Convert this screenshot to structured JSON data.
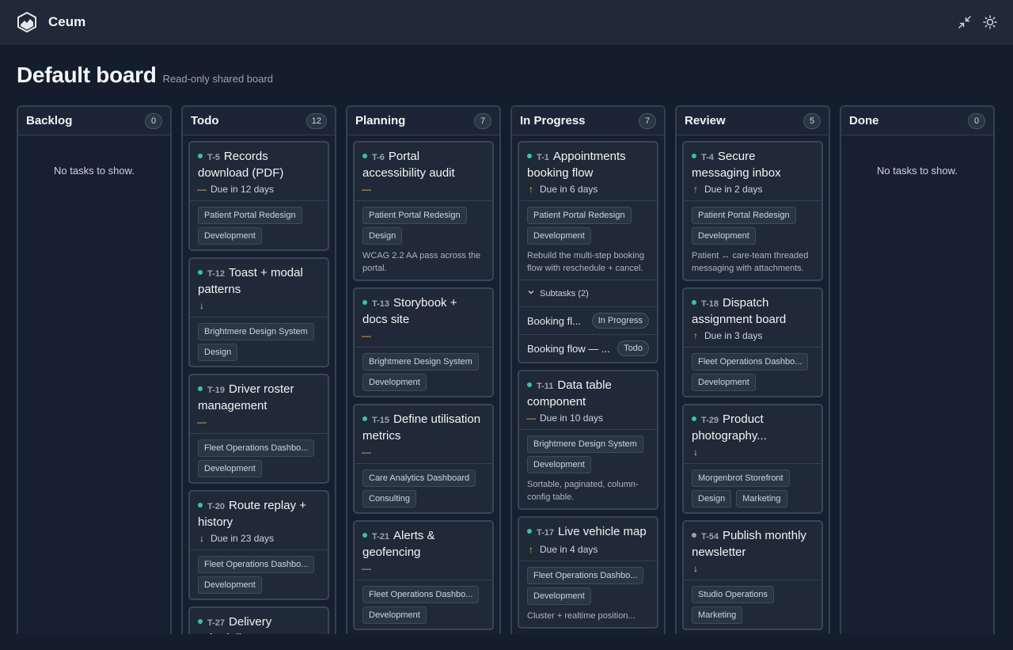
{
  "app": {
    "name": "Ceum"
  },
  "icons": {
    "collapse": "collapse-arrows-icon",
    "theme": "sun-icon"
  },
  "page": {
    "title": "Default board",
    "subtitle": "Read-only shared board"
  },
  "board": {
    "empty_text": "No tasks to show.",
    "subtasks_label": "Subtasks (2)",
    "columns": [
      {
        "title": "Backlog",
        "count": "0",
        "cards": []
      },
      {
        "title": "Todo",
        "count": "12",
        "cards": [
          {
            "id": "T-5",
            "title": "Records download (PDF)",
            "priority": "medium",
            "due": "Due in 12 days",
            "tags": [
              "Patient Portal Redesign",
              "Development"
            ]
          },
          {
            "id": "T-12",
            "title": "Toast + modal patterns",
            "priority": "low",
            "due": "",
            "tags": [
              "Brightmere Design System",
              "Design"
            ]
          },
          {
            "id": "T-19",
            "title": "Driver roster management",
            "priority": "medium",
            "due": "",
            "tags": [
              "Fleet Operations Dashbo...",
              "Development"
            ]
          },
          {
            "id": "T-20",
            "title": "Route replay + history",
            "priority": "low",
            "due": "Due in 23 days",
            "tags": [
              "Fleet Operations Dashbo...",
              "Development"
            ]
          },
          {
            "id": "T-27",
            "title": "Delivery scheduling...",
            "priority": "medium",
            "due": "",
            "tags": []
          }
        ]
      },
      {
        "title": "Planning",
        "count": "7",
        "cards": [
          {
            "id": "T-6",
            "title": "Portal accessibility audit",
            "priority": "medium",
            "due": "",
            "tags": [
              "Patient Portal Redesign",
              "Design"
            ],
            "description": "WCAG 2.2 AA pass across the portal."
          },
          {
            "id": "T-13",
            "title": "Storybook + docs site",
            "priority": "medium",
            "due": "",
            "tags": [
              "Brightmere Design System",
              "Development"
            ]
          },
          {
            "id": "T-15",
            "title": "Define utilisation metrics",
            "priority": "medium",
            "due": "",
            "tags": [
              "Care Analytics Dashboard",
              "Consulting"
            ]
          },
          {
            "id": "T-21",
            "title": "Alerts & geofencing",
            "priority": "medium",
            "due": "",
            "tags": [
              "Fleet Operations Dashbo...",
              "Development"
            ]
          }
        ]
      },
      {
        "title": "In Progress",
        "count": "7",
        "cards": [
          {
            "id": "T-1",
            "title": "Appointments booking flow",
            "priority": "high",
            "due": "Due in 6 days",
            "tags": [
              "Patient Portal Redesign",
              "Development"
            ],
            "description": "Rebuild the multi-step booking flow with reschedule + cancel.",
            "subtasks": [
              {
                "name": "Booking fl...",
                "status": "In Progress"
              },
              {
                "name": "Booking flow — ...",
                "status": "Todo"
              }
            ]
          },
          {
            "id": "T-11",
            "title": "Data table component",
            "priority": "medium",
            "due": "Due in 10 days",
            "tags": [
              "Brightmere Design System",
              "Development"
            ],
            "description": "Sortable, paginated, column-config table."
          },
          {
            "id": "T-17",
            "title": "Live vehicle map",
            "priority": "high",
            "due": "Due in 4 days",
            "tags": [
              "Fleet Operations Dashbo...",
              "Development"
            ],
            "description": "Cluster + realtime position..."
          }
        ]
      },
      {
        "title": "Review",
        "count": "5",
        "cards": [
          {
            "id": "T-4",
            "title": "Secure messaging inbox",
            "priority": "high",
            "due": "Due in 2 days",
            "tags": [
              "Patient Portal Redesign",
              "Development"
            ],
            "description": "Patient ↔ care-team threaded messaging with attachments."
          },
          {
            "id": "T-18",
            "title": "Dispatch assignment board",
            "priority": "high",
            "due": "Due in 3 days",
            "tags": [
              "Fleet Operations Dashbo...",
              "Development"
            ]
          },
          {
            "id": "T-29",
            "title": "Product photography...",
            "priority": "low",
            "due": "",
            "tags": [
              "Morgenbrot Storefront",
              "Design",
              "Marketing"
            ]
          },
          {
            "id": "T-54",
            "title": "Publish monthly newsletter",
            "priority": "low",
            "due": "",
            "tags": [
              "Studio Operations",
              "Marketing"
            ],
            "dot": "gray"
          }
        ]
      },
      {
        "title": "Done",
        "count": "0",
        "cards": []
      }
    ]
  }
}
